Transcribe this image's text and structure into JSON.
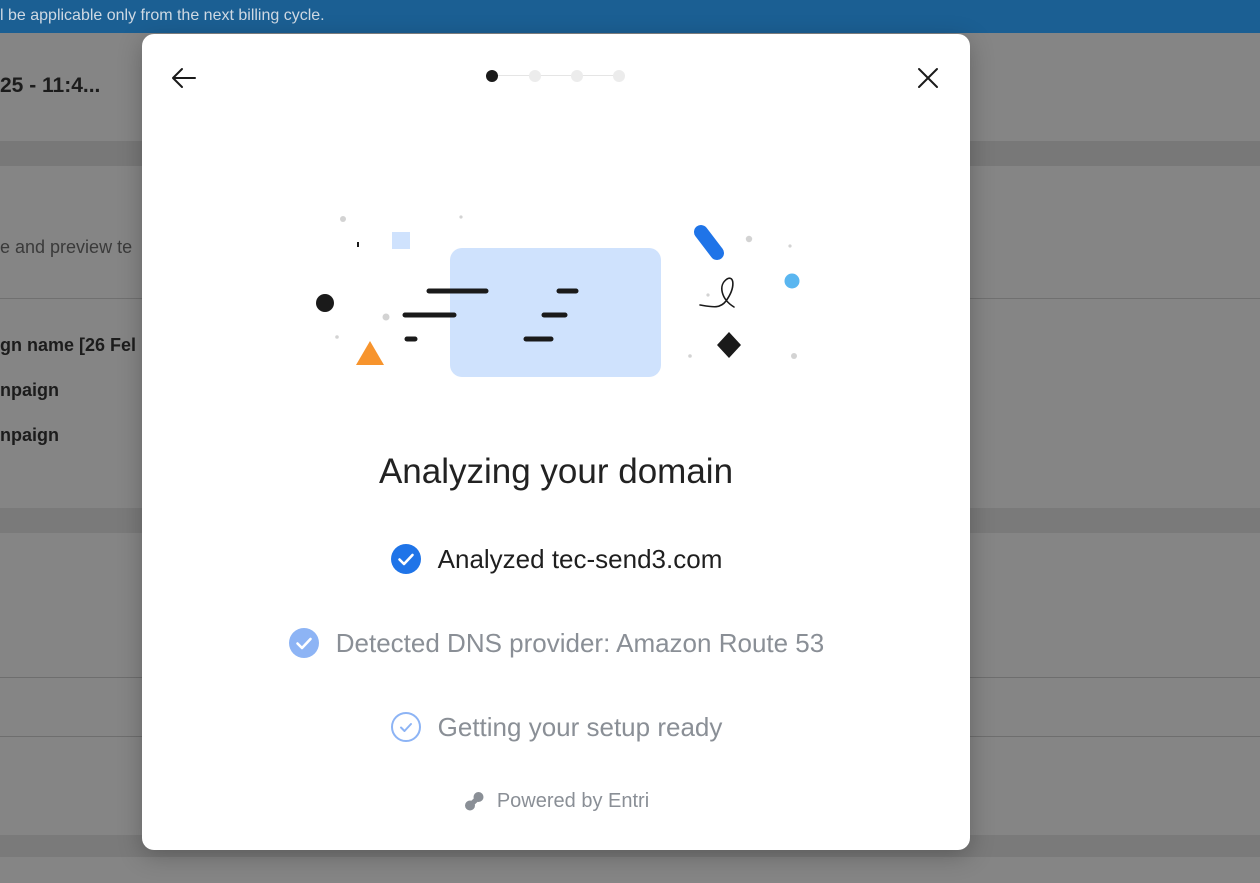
{
  "background": {
    "banner_text": "l be applicable only from the next billing cycle.",
    "title": "25 - 11:4...",
    "description": "e and preview te",
    "items": [
      "gn name [26 Fel",
      "npaign",
      "npaign"
    ]
  },
  "modal": {
    "stepper": {
      "total": 4,
      "current": 1
    },
    "heading": "Analyzing your domain",
    "steps": [
      {
        "text": "Analyzed tec-send3.com",
        "state": "done",
        "icon": "check-circle-filled-icon"
      },
      {
        "text": "Detected DNS provider:  Amazon Route 53",
        "state": "done-faded",
        "icon": "check-circle-light-icon"
      },
      {
        "text": "Getting your setup ready",
        "state": "in-progress",
        "icon": "check-circle-outline-icon"
      }
    ],
    "powered_by": "Powered by Entri",
    "colors": {
      "accent": "#1f74e8",
      "accent_light": "#8db4f5",
      "illustration_panel": "#cfe2fd",
      "triangle": "#f7942d",
      "dot_blue": "#5ab6f0"
    }
  }
}
